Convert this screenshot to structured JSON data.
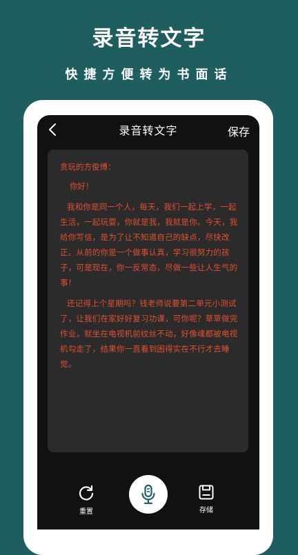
{
  "promo": {
    "title": "录音转文字",
    "subtitle": "快捷方便转为书面话"
  },
  "nav": {
    "back_icon": "chevron-left-icon",
    "title": "录音转文字",
    "save_label": "保存"
  },
  "letter": {
    "greeting": "贪玩的方俊博：",
    "salutation": "你好！",
    "paragraphs": [
      "我和你是同一个人，每天，我们一起上学，一起生活，一起玩耍，你就是我，我就是你。今天，我给你写信，是为了让不知道自己的缺点，尽快改正。从前的你是一个做事认真，学习很努力的孩子，可是现在，你一反常态，尽做一些让人生气的事！",
      "还记得上个星期吗？钱老师说要第二单元小测试了，让我们在家好好复习功课，可你呢？草草做完作业，就坐在电视机前纹丝不动，好像魂都被电视机勾走了，结果你一直看到困得实在不行才去睡觉。"
    ],
    "text_color": "#e0502f"
  },
  "controls": {
    "reset_label": "重置",
    "reset_icon": "refresh-icon",
    "mic_icon": "microphone-icon",
    "store_label": "存储",
    "store_icon": "save-disk-icon"
  },
  "colors": {
    "background": "#1e5e5e",
    "phone_frame": "#ffffff",
    "screen": "#111111",
    "card": "#2b2b2b"
  }
}
